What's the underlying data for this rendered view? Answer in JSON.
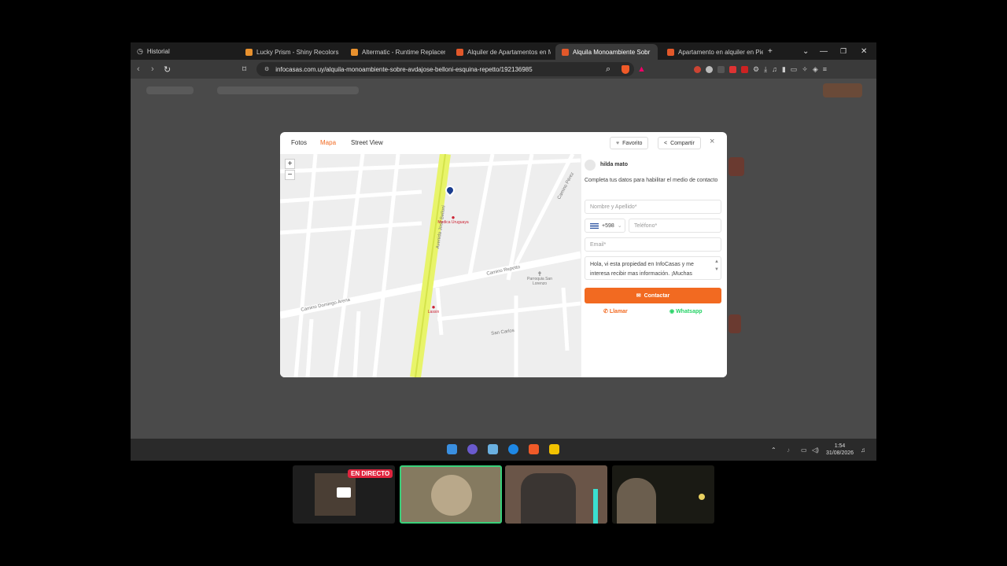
{
  "browser": {
    "history_label": "Historial",
    "tabs": [
      {
        "title": "Lucky Prism - Shiny Recolors for",
        "favicon_color": "#e8912e",
        "active": false
      },
      {
        "title": "Altermatic - Runtime Replacer F",
        "favicon_color": "#e8912e",
        "active": false
      },
      {
        "title": "Alquiler de Apartamentos en Mo",
        "favicon_color": "#e2582a",
        "active": false
      },
      {
        "title": "Alquila Monoambiente Sobr",
        "favicon_color": "#e2582a",
        "active": true
      },
      {
        "title": "Apartamento en alquiler en Pied",
        "favicon_color": "#e2582a",
        "active": false
      }
    ],
    "new_tab": "+",
    "url": "infocasas.com.uy/alquila-monoambiente-sobre-avdajose-belloni-esquina-repetto/192136985"
  },
  "modal": {
    "tabs": [
      "Fotos",
      "Mapa",
      "Street View"
    ],
    "selected_tab": "Mapa",
    "favorite_label": "Favorito",
    "share_label": "Compartir",
    "close": "×"
  },
  "map": {
    "zoom_in": "+",
    "zoom_out": "−",
    "streets": [
      "Avenida José Belloni",
      "Camino Repetto",
      "Camino Domingo Arena",
      "San Carlos",
      "Camino Pérez"
    ],
    "pois": [
      "Medica Uruguaya",
      "Parroquia San Lorenzo",
      "Lassin"
    ]
  },
  "contact": {
    "agent_name": "hilda mato",
    "intro": "Completa tus datos para habilitar el medio de contacto",
    "name_placeholder": "Nombre y Apellido*",
    "country_code": "+598",
    "phone_placeholder": "Teléfono*",
    "email_placeholder": "Email*",
    "message": "Hola, vi esta propiedad en InfoCasas y me interesa recibir mas información. ¡Muchas",
    "contact_button": "Contactar",
    "call_label": "Llamar",
    "whatsapp_label": "Whatsapp",
    "accent_color": "#f26a21",
    "whatsapp_color": "#25d366"
  },
  "taskbar": {
    "time": "1:54",
    "date": "31/08/2026"
  },
  "stream": {
    "live_badge": "EN DIRECTO"
  }
}
